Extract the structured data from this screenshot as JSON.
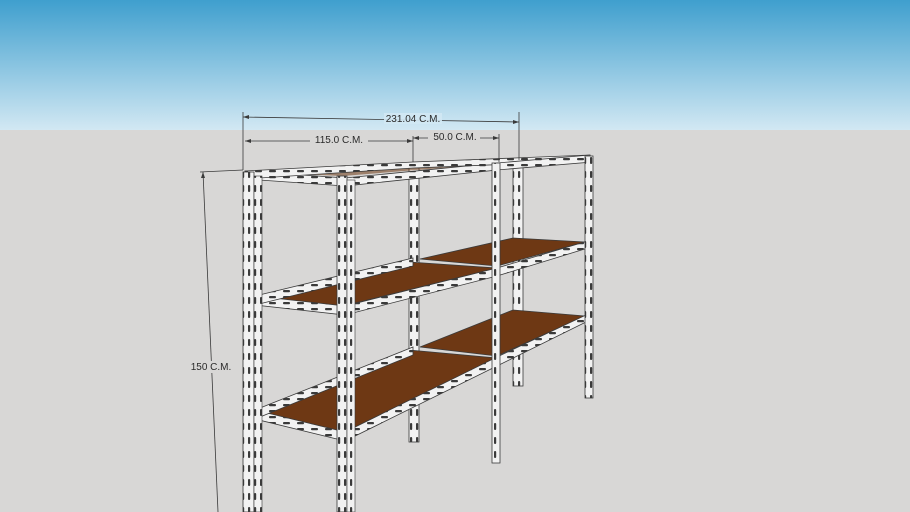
{
  "scene": {
    "sky_top_color": "#3f9fce",
    "sky_bottom_color": "#d2e8f3",
    "ground_color": "#d8d7d6",
    "shelf_board_color": "#6e3814",
    "shelf_board_dark": "#4d260d",
    "frame_color": "#f2f2f2",
    "frame_edge_color": "#3a3a3a",
    "dimension_line_color": "#3a3a3a"
  },
  "dimensions": {
    "overall_width": "231.04 C.M.",
    "section_width": "115.0 C.M.",
    "depth": "50.0 C.M.",
    "height": "150 C.M."
  }
}
